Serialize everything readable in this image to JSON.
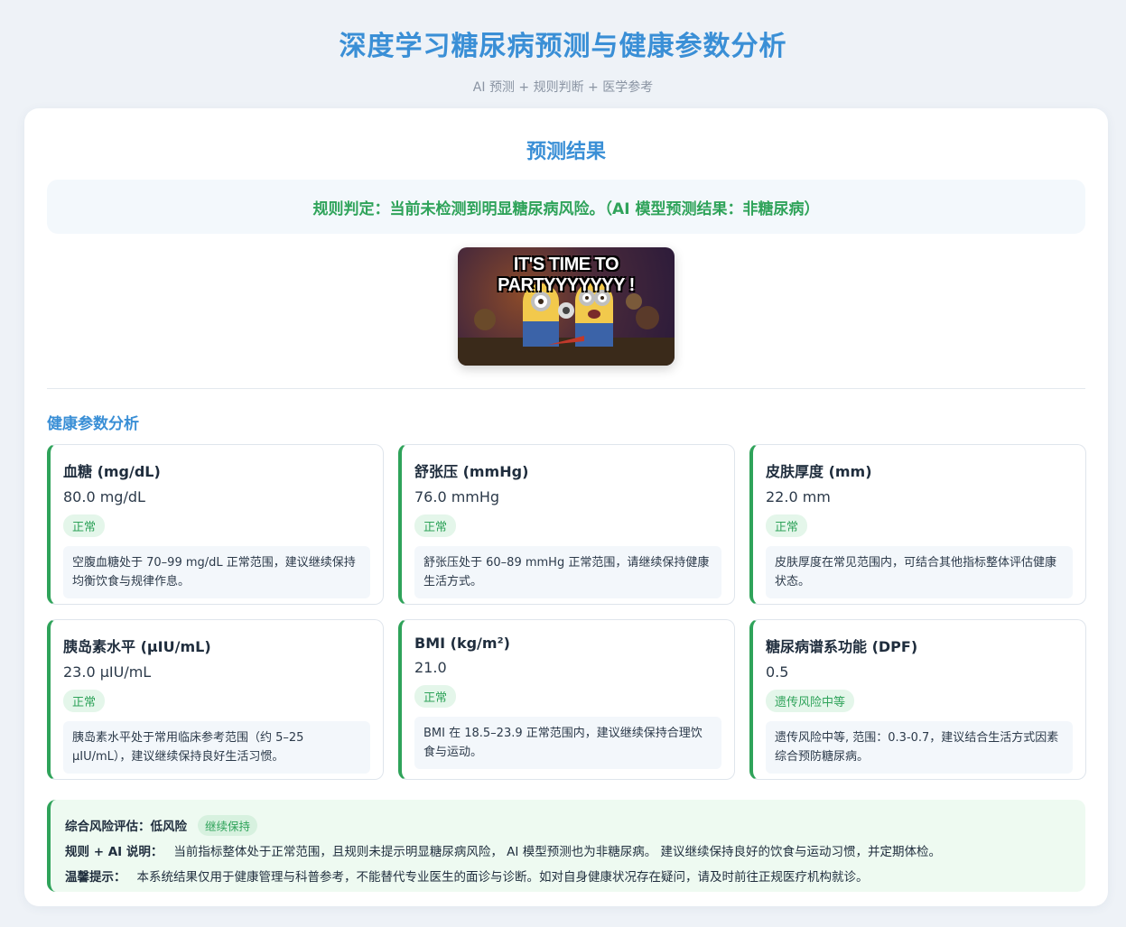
{
  "header": {
    "title": "深度学习糖尿病预测与健康参数分析",
    "subtitle": "AI 预测 + 规则判断 + 医学参考"
  },
  "result": {
    "section_title": "预测结果",
    "verdict": "规则判定：当前未检测到明显糖尿病风险。（AI 模型预测结果：非糖尿病）",
    "meme_caption": "IT'S TIME TO PARTYYYYYYY !"
  },
  "analysis": {
    "title": "健康参数分析",
    "params": [
      {
        "name": "血糖 (mg/dL)",
        "value": "80.0 mg/dL",
        "status": "正常",
        "note": "空腹血糖处于 70–99 mg/dL 正常范围，建议继续保持均衡饮食与规律作息。"
      },
      {
        "name": "舒张压 (mmHg)",
        "value": "76.0 mmHg",
        "status": "正常",
        "note": "舒张压处于 60–89 mmHg 正常范围，请继续保持健康生活方式。"
      },
      {
        "name": "皮肤厚度 (mm)",
        "value": "22.0 mm",
        "status": "正常",
        "note": "皮肤厚度在常见范围内，可结合其他指标整体评估健康状态。"
      },
      {
        "name": "胰岛素水平 (µIU/mL)",
        "value": "23.0 µIU/mL",
        "status": "正常",
        "note": "胰岛素水平处于常用临床参考范围（约 5–25 µIU/mL），建议继续保持良好生活习惯。"
      },
      {
        "name": "BMI (kg/m²)",
        "value": "21.0",
        "status": "正常",
        "note": "BMI 在 18.5–23.9 正常范围内，建议继续保持合理饮食与运动。"
      },
      {
        "name": "糖尿病谱系功能 (DPF)",
        "value": "0.5",
        "status": "遗传风险中等",
        "note": "遗传风险中等, 范围：0.3-0.7，建议结合生活方式因素综合预防糖尿病。"
      }
    ]
  },
  "summary": {
    "risk_label": "综合风险评估：",
    "risk_value": "低风险",
    "risk_badge": "继续保持",
    "explain_label": "规则 + AI 说明：",
    "explain_text": "当前指标整体处于正常范围，且规则未提示明显糖尿病风险， AI 模型预测也为非糖尿病。 建议继续保持良好的饮食与运动习惯，并定期体检。",
    "tip_label": "温馨提示：",
    "tip_text": "本系统结果仅用于健康管理与科普参考，不能替代专业医生的面诊与诊断。如对自身健康状况存在疑问，请及时前往正规医疗机构就诊。"
  },
  "colors": {
    "accent_blue": "#3a8fd6",
    "status_green": "#2fa35a"
  }
}
